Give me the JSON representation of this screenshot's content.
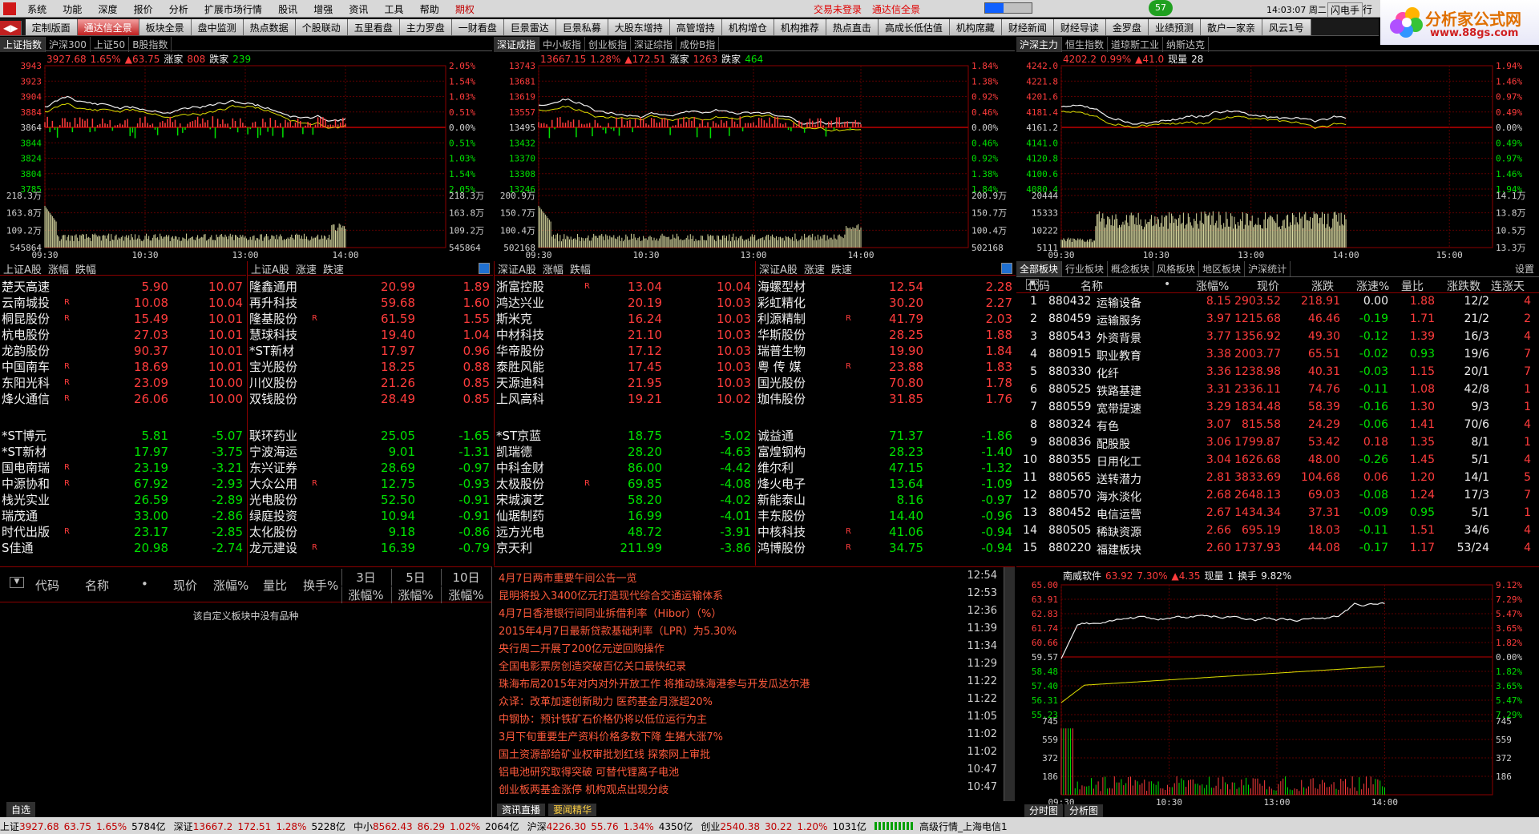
{
  "menu": {
    "items": [
      "系统",
      "功能",
      "深度",
      "报价",
      "分析",
      "扩展市场行情",
      "股讯",
      "增强",
      "资讯",
      "工具",
      "帮助",
      "期权"
    ],
    "trade_status": "交易未登录",
    "app_title": "通达信全景",
    "badge": "57",
    "time": "14:03:07 周二",
    "mode": "闪电手",
    "mode2": "行"
  },
  "tabs": [
    "定制版面",
    "通达信全景",
    "板块全景",
    "盘中监测",
    "热点数据",
    "个股联动",
    "五里看盘",
    "主力罗盘",
    "一财看盘",
    "巨景雷达",
    "巨景私募",
    "大股东增持",
    "高管增持",
    "机构增仓",
    "机构推荐",
    "热点直击",
    "高成长低估值",
    "机构席藏",
    "财经新闻",
    "财经导读",
    "金罗盘",
    "业绩预测",
    "散户一家亲",
    "风云1号"
  ],
  "active_tab": "通达信全景",
  "logo": {
    "name": "分析家公式网",
    "url": "www.88gs.com"
  },
  "chart1": {
    "tabs": [
      "上证指数",
      "沪深300",
      "上证50",
      "B股指数"
    ],
    "info": {
      "price": "3927.68",
      "pct": "1.65%",
      "chg": "▲63.75",
      "up_label": "涨家",
      "up": "808",
      "down_label": "跌家",
      "down": "239"
    },
    "left_ticks": [
      "3943",
      "3923",
      "3904",
      "3884",
      "3864",
      "3844",
      "3824",
      "3804",
      "3785"
    ],
    "right_ticks": [
      "2.05%",
      "1.54%",
      "1.03%",
      "0.51%",
      "0.00%",
      "0.51%",
      "1.03%",
      "1.54%",
      "2.05%"
    ],
    "vol_left": [
      "218.3万",
      "163.8万",
      "109.2万",
      "545864"
    ],
    "vol_right": [
      "218.3万",
      "163.8万",
      "109.2万",
      "545864"
    ],
    "time_ticks": [
      "09:30",
      "10:30",
      "13:00",
      "14:00"
    ]
  },
  "chart2": {
    "tabs": [
      "深证成指",
      "中小板指",
      "创业板指",
      "深证综指",
      "成份B指"
    ],
    "info": {
      "price": "13667.15",
      "pct": "1.28%",
      "chg": "▲172.51",
      "up_label": "涨家",
      "up": "1263",
      "down_label": "跌家",
      "down": "464"
    },
    "left_ticks": [
      "13743",
      "13681",
      "13619",
      "13557",
      "13495",
      "13432",
      "13370",
      "13308",
      "13246"
    ],
    "right_ticks": [
      "1.84%",
      "1.38%",
      "0.92%",
      "0.46%",
      "0.00%",
      "0.46%",
      "0.92%",
      "1.38%",
      "1.84%"
    ],
    "vol_left": [
      "200.9万",
      "150.7万",
      "100.4万",
      "502168"
    ],
    "vol_right": [
      "200.9万",
      "150.7万",
      "100.4万",
      "502168"
    ],
    "time_ticks": [
      "09:30",
      "10:30",
      "13:00",
      "14:00"
    ]
  },
  "chart3": {
    "tabs": [
      "沪深主力",
      "恒生指数",
      "道琼斯工业",
      "纳斯达克"
    ],
    "info": {
      "price": "4202.2",
      "pct": "0.99%",
      "chg": "▲41.0",
      "vol_label": "现量",
      "vol": "28"
    },
    "left_ticks": [
      "4242.0",
      "4221.8",
      "4201.6",
      "4181.4",
      "4161.2",
      "4141.0",
      "4120.8",
      "4100.6",
      "4080.4"
    ],
    "right_ticks": [
      "1.94%",
      "1.46%",
      "0.97%",
      "0.49%",
      "0.00%",
      "0.49%",
      "0.97%",
      "1.46%",
      "1.94%"
    ],
    "vol_left": [
      "20444",
      "15333",
      "10222",
      "5111"
    ],
    "vol_right": [
      "14.1万",
      "13.8万",
      "10.5万",
      "13.3万"
    ],
    "time_ticks": [
      "09:30",
      "10:30",
      "13:00",
      "14:00",
      "15:00"
    ]
  },
  "rank": {
    "heads": [
      {
        "a": "上证A股",
        "b": "涨幅",
        "c": "跌幅"
      },
      {
        "a": "上证A股",
        "b": "涨速",
        "c": "跌速"
      },
      {
        "a": "深证A股",
        "b": "涨幅",
        "c": "跌幅"
      },
      {
        "a": "深证A股",
        "b": "涨速",
        "c": "跌速"
      }
    ],
    "columns": [
      {
        "top": [
          [
            "楚天高速",
            "",
            "5.90",
            "10.07"
          ],
          [
            "云南城投",
            "R",
            "10.08",
            "10.04"
          ],
          [
            "桐昆股份",
            "R",
            "15.49",
            "10.01"
          ],
          [
            "杭电股份",
            "",
            "27.03",
            "10.01"
          ],
          [
            "龙韵股份",
            "",
            "90.37",
            "10.01"
          ],
          [
            "中国南车",
            "R",
            "18.69",
            "10.01"
          ],
          [
            "东阳光科",
            "R",
            "23.09",
            "10.00"
          ],
          [
            "烽火通信",
            "R",
            "26.06",
            "10.00"
          ]
        ],
        "bottom": [
          [
            "*ST博元",
            "",
            "5.81",
            "-5.07"
          ],
          [
            "*ST新材",
            "",
            "17.97",
            "-3.75"
          ],
          [
            "国电南瑞",
            "R",
            "23.19",
            "-3.21"
          ],
          [
            "中源协和",
            "R",
            "67.92",
            "-2.93"
          ],
          [
            "栈光实业",
            "",
            "26.59",
            "-2.89"
          ],
          [
            "瑞茂通",
            "",
            "33.00",
            "-2.86"
          ],
          [
            "时代出版",
            "R",
            "23.17",
            "-2.85"
          ],
          [
            "S佳通",
            "",
            "20.98",
            "-2.74"
          ]
        ]
      },
      {
        "top": [
          [
            "隆鑫通用",
            "",
            "20.99",
            "1.89"
          ],
          [
            "再升科技",
            "",
            "59.68",
            "1.60"
          ],
          [
            "隆基股份",
            "R",
            "61.59",
            "1.55"
          ],
          [
            "慧球科技",
            "",
            "19.40",
            "1.04"
          ],
          [
            "*ST新材",
            "",
            "17.97",
            "0.96"
          ],
          [
            "宝光股份",
            "",
            "18.25",
            "0.88"
          ],
          [
            "川仪股份",
            "",
            "21.26",
            "0.85"
          ],
          [
            "双钱股份",
            "",
            "28.49",
            "0.85"
          ]
        ],
        "bottom": [
          [
            "联环药业",
            "",
            "25.05",
            "-1.65"
          ],
          [
            "宁波海运",
            "",
            "9.01",
            "-1.31"
          ],
          [
            "东兴证券",
            "",
            "28.69",
            "-0.97"
          ],
          [
            "大众公用",
            "R",
            "12.75",
            "-0.93"
          ],
          [
            "光电股份",
            "",
            "52.50",
            "-0.91"
          ],
          [
            "绿庭投资",
            "",
            "10.94",
            "-0.91"
          ],
          [
            "太化股份",
            "",
            "9.18",
            "-0.86"
          ],
          [
            "龙元建设",
            "R",
            "16.39",
            "-0.79"
          ]
        ]
      },
      {
        "top": [
          [
            "浙富控股",
            "R",
            "13.04",
            "10.04"
          ],
          [
            "鸿达兴业",
            "",
            "20.19",
            "10.03"
          ],
          [
            "斯米克",
            "",
            "16.24",
            "10.03"
          ],
          [
            "中材科技",
            "",
            "21.10",
            "10.03"
          ],
          [
            "华帝股份",
            "",
            "17.12",
            "10.03"
          ],
          [
            "泰胜风能",
            "",
            "17.45",
            "10.03"
          ],
          [
            "天源迪科",
            "",
            "21.95",
            "10.03"
          ],
          [
            "上风高科",
            "",
            "19.21",
            "10.02"
          ]
        ],
        "bottom": [
          [
            "*ST京蓝",
            "",
            "18.75",
            "-5.02"
          ],
          [
            "凯瑞德",
            "",
            "28.20",
            "-4.63"
          ],
          [
            "中科金财",
            "",
            "86.00",
            "-4.42"
          ],
          [
            "太极股份",
            "R",
            "69.85",
            "-4.08"
          ],
          [
            "宋城演艺",
            "",
            "58.20",
            "-4.02"
          ],
          [
            "仙琚制药",
            "",
            "16.99",
            "-4.01"
          ],
          [
            "远方光电",
            "",
            "48.72",
            "-3.91"
          ],
          [
            "京天利",
            "",
            "211.99",
            "-3.86"
          ]
        ]
      },
      {
        "top": [
          [
            "海螺型材",
            "",
            "12.54",
            "2.28"
          ],
          [
            "彩虹精化",
            "",
            "30.20",
            "2.27"
          ],
          [
            "利源精制",
            "R",
            "41.79",
            "2.03"
          ],
          [
            "华斯股份",
            "",
            "28.25",
            "1.88"
          ],
          [
            "瑞普生物",
            "",
            "19.90",
            "1.84"
          ],
          [
            "粤 传 媒",
            "R",
            "23.88",
            "1.83"
          ],
          [
            "国光股份",
            "",
            "70.80",
            "1.78"
          ],
          [
            "珈伟股份",
            "",
            "31.85",
            "1.76"
          ]
        ],
        "bottom": [
          [
            "诚益通",
            "",
            "71.37",
            "-1.86"
          ],
          [
            "富煌钢构",
            "",
            "28.23",
            "-1.40"
          ],
          [
            "维尔利",
            "",
            "47.15",
            "-1.32"
          ],
          [
            "烽火电子",
            "",
            "13.64",
            "-1.09"
          ],
          [
            "新能泰山",
            "",
            "8.16",
            "-0.97"
          ],
          [
            "丰东股份",
            "",
            "14.40",
            "-0.96"
          ],
          [
            "中核科技",
            "R",
            "41.06",
            "-0.94"
          ],
          [
            "鸿博股份",
            "R",
            "34.75",
            "-0.94"
          ]
        ]
      }
    ]
  },
  "sectors": {
    "tabs": [
      "全部板块",
      "行业板块",
      "概念板块",
      "风格板块",
      "地区板块",
      "沪深统计"
    ],
    "settings": "设置",
    "headers": [
      "代码",
      "名称",
      "•",
      "涨幅%",
      "现价",
      "涨跌",
      "涨速%",
      "量比",
      "涨跌数",
      "连涨天"
    ],
    "rows": [
      [
        "1",
        "880432",
        "运输设备",
        "8.15",
        "2903.52",
        "218.91",
        "0.00",
        "1.88",
        "12/2",
        "4"
      ],
      [
        "2",
        "880459",
        "运输服务",
        "3.97",
        "1215.68",
        "46.46",
        "-0.19",
        "1.71",
        "21/2",
        "2"
      ],
      [
        "3",
        "880543",
        "外资背景",
        "3.77",
        "1356.92",
        "49.30",
        "-0.12",
        "1.39",
        "16/3",
        "4"
      ],
      [
        "4",
        "880915",
        "职业教育",
        "3.38",
        "2003.77",
        "65.51",
        "-0.02",
        "0.93",
        "19/6",
        "7"
      ],
      [
        "5",
        "880330",
        "化纤",
        "3.36",
        "1238.98",
        "40.31",
        "-0.03",
        "1.15",
        "20/1",
        "7"
      ],
      [
        "6",
        "880525",
        "铁路基建",
        "3.31",
        "2336.11",
        "74.76",
        "-0.11",
        "1.08",
        "42/8",
        "1"
      ],
      [
        "7",
        "880559",
        "宽带提速",
        "3.29",
        "1834.48",
        "58.39",
        "-0.16",
        "1.30",
        "9/3",
        "1"
      ],
      [
        "8",
        "880324",
        "有色",
        "3.07",
        "815.58",
        "24.29",
        "-0.06",
        "1.41",
        "70/6",
        "4"
      ],
      [
        "9",
        "880836",
        "配股股",
        "3.06",
        "1799.87",
        "53.42",
        "0.18",
        "1.35",
        "8/1",
        "1"
      ],
      [
        "10",
        "880355",
        "日用化工",
        "3.04",
        "1626.68",
        "48.00",
        "-0.26",
        "1.45",
        "5/1",
        "4"
      ],
      [
        "11",
        "880565",
        "送转潜力",
        "2.81",
        "3833.69",
        "104.68",
        "0.06",
        "1.20",
        "14/1",
        "5"
      ],
      [
        "12",
        "880570",
        "海水淡化",
        "2.68",
        "2648.13",
        "69.03",
        "-0.08",
        "1.24",
        "17/3",
        "7"
      ],
      [
        "13",
        "880452",
        "电信运营",
        "2.67",
        "1434.34",
        "37.31",
        "-0.09",
        "0.95",
        "5/1",
        "1"
      ],
      [
        "14",
        "880505",
        "稀缺资源",
        "2.66",
        "695.19",
        "18.03",
        "-0.11",
        "1.51",
        "34/6",
        "4"
      ],
      [
        "15",
        "880220",
        "福建板块",
        "2.60",
        "1737.93",
        "44.08",
        "-0.17",
        "1.17",
        "53/24",
        "4"
      ]
    ]
  },
  "custom": {
    "headers": [
      "代码",
      "名称",
      "•",
      "现价",
      "涨幅%",
      "量比",
      "换手%"
    ],
    "period_heads": [
      "3日",
      "5日",
      "10日"
    ],
    "period_sub": [
      "涨幅%",
      "涨幅%",
      "涨幅%"
    ],
    "empty_msg": "该自定义板块中没有品种",
    "bottom_tab": "自选"
  },
  "news": {
    "items": [
      [
        "4月7日两市重要午间公告一览",
        "12:54"
      ],
      [
        "昆明将投入3400亿元打造现代综合交通运输体系",
        "12:53"
      ],
      [
        "4月7日香港银行间同业拆借利率（Hibor）（%）",
        "12:36"
      ],
      [
        "2015年4月7日最新贷款基础利率（LPR）为5.30%",
        "11:39"
      ],
      [
        "央行周二开展了200亿元逆回购操作",
        "11:34"
      ],
      [
        "全国电影票房创造突破百亿关口最快纪录",
        "11:29"
      ],
      [
        "珠海布局2015年对内对外开放工作 将推动珠海港参与开发瓜达尔港",
        "11:22"
      ],
      [
        "众译：改革加速创新助力 医药基金月涨超20%",
        "11:22"
      ],
      [
        "中钢协：预计铁矿石价格仍将以低位运行为主",
        "11:05"
      ],
      [
        "3月下旬重要生产资料价格多数下降 生猪大涨7%",
        "11:02"
      ],
      [
        "国土资源部给矿业权审批划红线 探索网上审批",
        "11:02"
      ],
      [
        "铝电池研究取得突破 可替代锂离子电池",
        "10:47"
      ],
      [
        "创业板两基金涨停 机构观点出现分歧",
        "10:47"
      ]
    ],
    "tabs": [
      "资讯直播",
      "要闻精华"
    ]
  },
  "minichart": {
    "info": {
      "name": "南威软件",
      "price": "63.92",
      "pct": "7.30%",
      "chg": "▲4.35",
      "vol_label": "现量",
      "vol": "1",
      "turn_label": "换手",
      "turn": "9.82%"
    },
    "left_ticks": [
      "65.00",
      "63.91",
      "62.83",
      "61.74",
      "60.66",
      "59.57",
      "58.48",
      "57.40",
      "56.31",
      "55.23"
    ],
    "right_ticks": [
      "9.12%",
      "7.29%",
      "5.47%",
      "3.65%",
      "1.82%",
      "0.00%",
      "1.82%",
      "3.65%",
      "5.47%",
      "7.29%"
    ],
    "vol_ticks": [
      "745",
      "559",
      "372",
      "186"
    ],
    "time_ticks": [
      "09:30",
      "10:30",
      "13:00",
      "14:00"
    ],
    "tabs": [
      "分时图",
      "分析图"
    ]
  },
  "status": {
    "items": [
      {
        "name": "上证",
        "price": "3927.68",
        "chg": "63.75",
        "pct": "1.65%",
        "amt": "5784亿"
      },
      {
        "name": "深证",
        "price": "13667.2",
        "chg": "172.51",
        "pct": "1.28%",
        "amt": "5228亿"
      },
      {
        "name": "中小",
        "price": "8562.43",
        "chg": "86.29",
        "pct": "1.02%",
        "amt": "2064亿"
      },
      {
        "name": "沪深",
        "price": "4226.30",
        "chg": "55.76",
        "pct": "1.34%",
        "amt": "4350亿"
      },
      {
        "name": "创业",
        "price": "2540.38",
        "chg": "30.22",
        "pct": "1.20%",
        "amt": "1031亿"
      }
    ],
    "server": "高级行情_上海电信1"
  },
  "colors": {
    "up": "#ff3c3c",
    "down": "#00e000",
    "grid": "#8b0000",
    "bg": "#000000"
  }
}
